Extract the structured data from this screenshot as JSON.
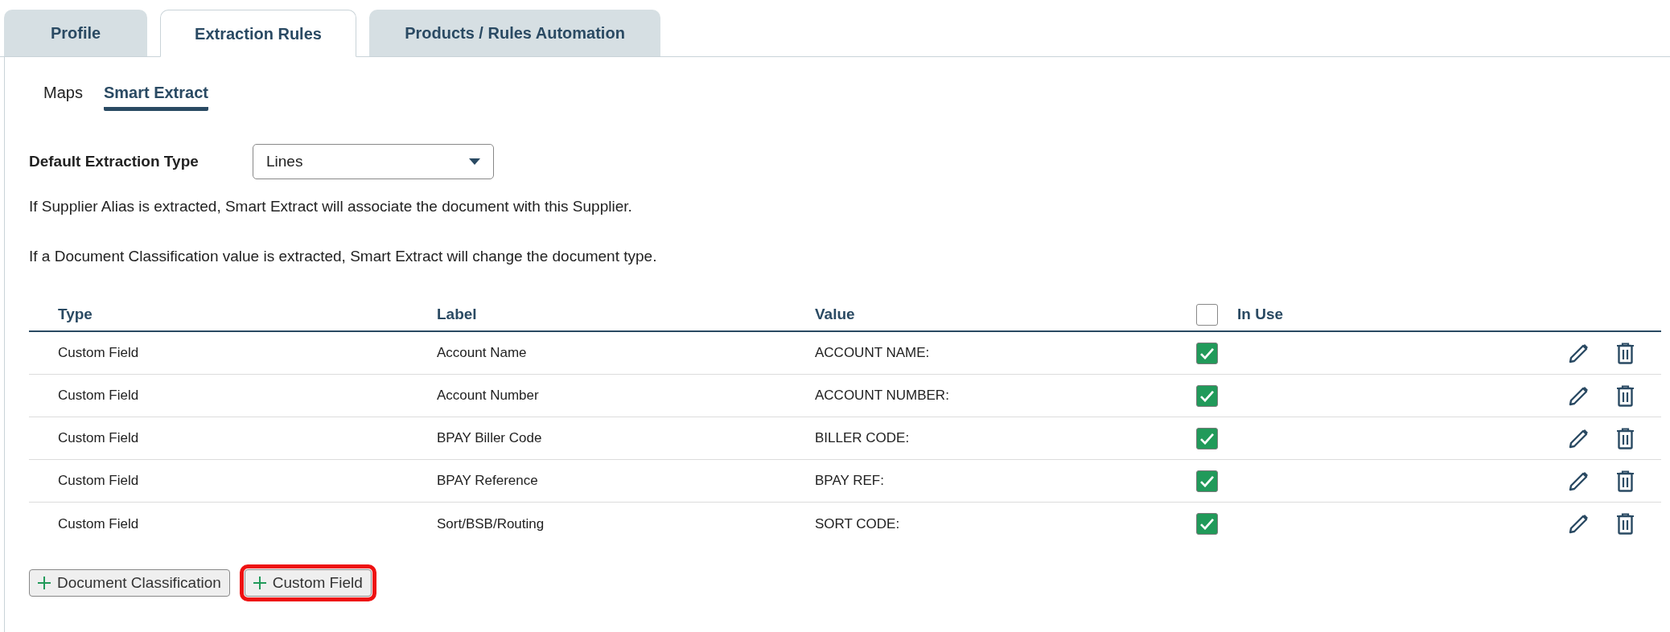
{
  "tabs": [
    {
      "label": "Profile",
      "selected": false
    },
    {
      "label": "Extraction Rules",
      "selected": true
    },
    {
      "label": "Products / Rules Automation",
      "selected": false
    }
  ],
  "subtabs": [
    {
      "label": "Maps",
      "selected": false
    },
    {
      "label": "Smart Extract",
      "selected": true
    }
  ],
  "default_extraction_type": {
    "label": "Default Extraction Type",
    "value": "Lines"
  },
  "notes": [
    "If Supplier Alias is extracted, Smart Extract will associate the document with this Supplier.",
    "If a Document Classification value is extracted, Smart Extract will change the document type."
  ],
  "table": {
    "columns": [
      "Type",
      "Label",
      "Value",
      "In Use"
    ],
    "select_all_checked": false,
    "rows": [
      {
        "type": "Custom Field",
        "label": "Account Name",
        "value": "ACCOUNT NAME:",
        "in_use": true
      },
      {
        "type": "Custom Field",
        "label": "Account Number",
        "value": "ACCOUNT NUMBER:",
        "in_use": true
      },
      {
        "type": "Custom Field",
        "label": "BPAY Biller Code",
        "value": "BILLER CODE:",
        "in_use": true
      },
      {
        "type": "Custom Field",
        "label": "BPAY Reference",
        "value": "BPAY REF:",
        "in_use": true
      },
      {
        "type": "Custom Field",
        "label": "Sort/BSB/Routing",
        "value": "SORT CODE:",
        "in_use": true
      }
    ]
  },
  "buttons": [
    {
      "label": "Document Classification",
      "highlighted": false
    },
    {
      "label": "Custom Field",
      "highlighted": true
    }
  ]
}
